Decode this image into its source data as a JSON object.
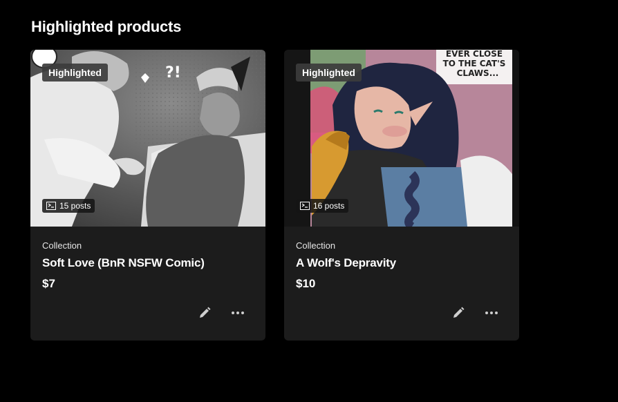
{
  "section": {
    "title": "Highlighted products"
  },
  "products": [
    {
      "badge": "Highlighted",
      "posts": "15 posts",
      "type": "Collection",
      "name": "Soft Love (BnR NSFW Comic)",
      "price": "$7"
    },
    {
      "badge": "Highlighted",
      "posts": "16 posts",
      "type": "Collection",
      "name": "A Wolf's Depravity",
      "price": "$10",
      "art_text": [
        "EVER CLOSE",
        "TO THE CAT'S",
        "CLAWS..."
      ]
    }
  ],
  "icons": {
    "posts": "posts-list-icon",
    "edit": "pencil-icon",
    "more": "more-dots-icon"
  },
  "colors": {
    "background": "#000000",
    "card": "#1c1c1c",
    "badge": "#3c3c3c"
  }
}
